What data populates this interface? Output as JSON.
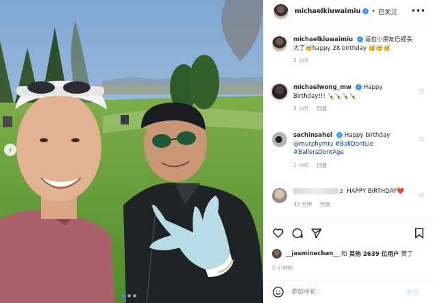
{
  "post": {
    "author": "michaelkiuwaimiu",
    "verified": true,
    "separator": "•",
    "follow_status": "已关注",
    "more_icon": "ellipsis-icon"
  },
  "caption": {
    "user": "michaelkiuwaimiu",
    "text": "這位小朋友已經長大了🥳happy 28 birthday 🥳🥳🥳",
    "time": "2 小时"
  },
  "comments": [
    {
      "user": "michaelwong_mw",
      "text": "Happy Birthday!!! 🍾🍾🍾🍾",
      "time": "2 小时",
      "reply_label": "回复"
    },
    {
      "user": "sachinsahel",
      "text_plain": "Happy birthday ",
      "mention": "@murphymiu",
      "hashtag1": "#BallDontLie",
      "hashtag2": "#BallersDontAge",
      "time": "1 小时",
      "reply_label": "回复"
    },
    {
      "user_suffix": "z",
      "text": "HAPPY BIRTHDAY❤️",
      "time": "33 分钟",
      "reply_label": "回复"
    }
  ],
  "likes": {
    "liked_by": "__jasminechan__",
    "joiner": "和",
    "others": "其他 2639 位用户",
    "suffix": "赞了"
  },
  "post_time": "2 小时前",
  "add_comment": {
    "placeholder": "添加评论...",
    "post_label": "发布"
  },
  "carousel": {
    "total": 3,
    "active_index": 0
  },
  "colors": {
    "link": "#00376b",
    "verified": "#3897f0",
    "meta": "#8e8e8e",
    "post_disabled": "#b2dffc",
    "active_dot": "#2f8cff"
  }
}
